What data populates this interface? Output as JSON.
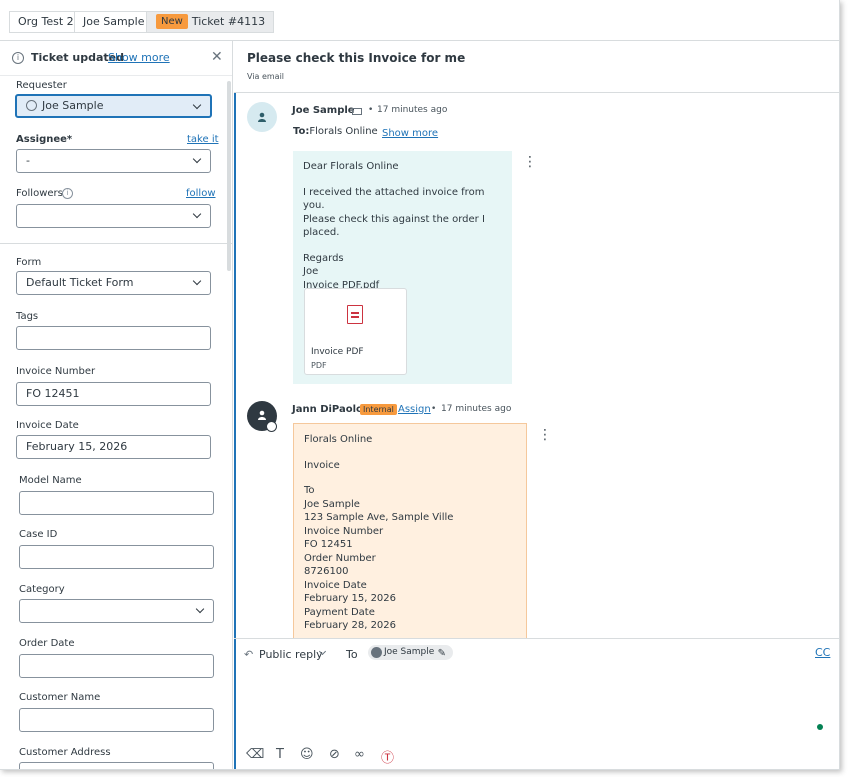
{
  "tabs": [
    {
      "label": "Org Test 2"
    },
    {
      "label": "Joe Sample"
    },
    {
      "badge": "New",
      "label": "Ticket #4113"
    }
  ],
  "notice": {
    "title": "Ticket updated",
    "more": "Show more"
  },
  "fields": {
    "requester": {
      "label": "Requester",
      "value": "Joe Sample"
    },
    "assignee": {
      "label": "Assignee*",
      "action": "take it",
      "value": "-"
    },
    "followers": {
      "label": "Followers",
      "action": "follow",
      "value": ""
    },
    "form": {
      "label": "Form",
      "value": "Default Ticket Form"
    },
    "tags": {
      "label": "Tags",
      "value": ""
    },
    "invoice_number": {
      "label": "Invoice Number",
      "value": "FO 12451"
    },
    "invoice_date": {
      "label": "Invoice Date",
      "value": "February 15, 2026"
    },
    "model_name": {
      "label": "Model Name",
      "value": ""
    },
    "case_id": {
      "label": "Case ID",
      "value": ""
    },
    "category": {
      "label": "Category",
      "value": ""
    },
    "order_date": {
      "label": "Order Date",
      "value": ""
    },
    "customer_name": {
      "label": "Customer Name",
      "value": ""
    },
    "customer_address": {
      "label": "Customer Address",
      "value": ""
    }
  },
  "ticket": {
    "subject": "Please check this Invoice for me",
    "via": "Via email"
  },
  "messages": [
    {
      "author": "Joe Sample",
      "time": "17 minutes ago",
      "to_label": "To:",
      "to_value": "Florals Online",
      "show_more": "Show more",
      "body": [
        "Dear Florals Online",
        "I received the attached invoice from you.",
        "Please check this against the order I placed.",
        "Regards",
        "Joe",
        "Invoice PDF.pdf"
      ],
      "attachment": {
        "name": "Invoice PDF",
        "type": "PDF"
      }
    },
    {
      "author": "Jann DiPaolo",
      "badge": "Internal",
      "assign": "Assign",
      "time": "17 minutes ago",
      "body": [
        "Florals Online",
        "Invoice",
        "To",
        "Joe Sample",
        "123 Sample Ave, Sample Ville",
        "Invoice Number",
        "FO 12451",
        "Order Number",
        "8726100",
        "Invoice Date",
        "February 15, 2026",
        "Payment Date",
        "February 28, 2026"
      ]
    }
  ],
  "reply": {
    "mode": "Public reply",
    "to_label": "To",
    "recipient": "Joe Sample",
    "cc": "CC"
  },
  "icons": {
    "info": "info-icon",
    "close": "close-icon",
    "chevron": "chevron-down-icon",
    "mail": "mail-icon",
    "kebab": "more-options-icon",
    "pdf": "pdf-file-icon",
    "pencil": "pencil-icon",
    "eraser": "eraser-icon",
    "text": "text-format-icon",
    "emoji": "emoji-icon",
    "paperclip": "paperclip-icon",
    "link": "link-icon",
    "macro": "macro-icon"
  },
  "colors": {
    "brand": "#1f73b7",
    "new_badge": "#f79a3e",
    "requester_bubble": "#e7f6f6",
    "internal_bubble": "#fff0e0",
    "online": "#038153"
  }
}
